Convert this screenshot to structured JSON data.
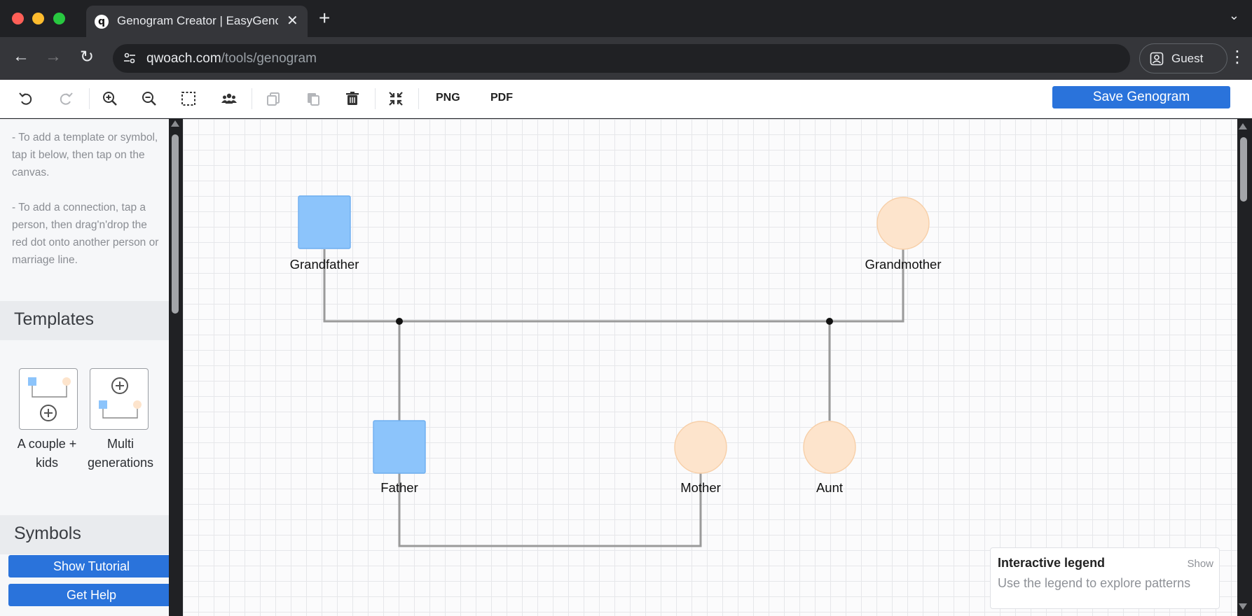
{
  "browser": {
    "tab_title": "Genogram Creator | EasyGenogram",
    "favicon_letter": "q",
    "url_domain": "qwoach.com",
    "url_path": "/tools/genogram",
    "profile_label": "Guest"
  },
  "toolbar": {
    "png_label": "PNG",
    "pdf_label": "PDF",
    "save_label": "Save Genogram",
    "icons": [
      "undo-icon",
      "redo-icon",
      "zoom-in-icon",
      "zoom-out-icon",
      "select-area-icon",
      "group-icon",
      "copy-icon",
      "paste-icon",
      "delete-icon",
      "fit-screen-icon"
    ]
  },
  "sidebar": {
    "instruction_1": "- To add a template or symbol, tap it below, then tap on the canvas.",
    "instruction_2": "- To add a connection, tap a person, then drag'n'drop the red dot onto another person or marriage line.",
    "templates_header": "Templates",
    "templates": [
      {
        "label": "A couple + kids"
      },
      {
        "label": "Multi generations"
      }
    ],
    "symbols_header": "Symbols",
    "tutorial_button": "Show Tutorial",
    "help_button": "Get Help"
  },
  "canvas": {
    "people": [
      {
        "name": "Grandfather",
        "shape": "square",
        "color": "#8cc4fb"
      },
      {
        "name": "Grandmother",
        "shape": "circle",
        "color": "#fde4cc"
      },
      {
        "name": "Father",
        "shape": "square",
        "color": "#8cc4fb"
      },
      {
        "name": "Mother",
        "shape": "circle",
        "color": "#fde4cc"
      },
      {
        "name": "Aunt",
        "shape": "circle",
        "color": "#fde4cc"
      }
    ],
    "legend": {
      "title": "Interactive legend",
      "toggle": "Show",
      "description": "Use the legend to explore patterns"
    }
  },
  "colors": {
    "accent": "#2a73db",
    "male": "#8cc4fb",
    "female": "#fde4cc",
    "connector": "#9a9a9a"
  }
}
